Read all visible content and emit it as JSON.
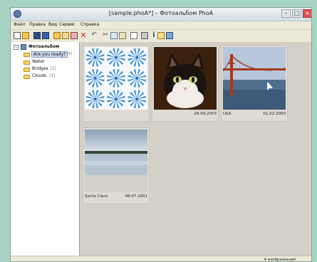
{
  "window": {
    "title": "[sample.phoA*] – Фотоальбом PhoA"
  },
  "menu": [
    "Файл",
    "Правка",
    "Вид",
    "Сервис",
    "Справка"
  ],
  "tree": {
    "root": "Фотоальбом",
    "items": [
      {
        "label": "Are you ready?",
        "count": "(4)",
        "selected": true
      },
      {
        "label": "Water",
        "count": ""
      },
      {
        "label": "Bridges",
        "count": "(1)"
      },
      {
        "label": "Clouds",
        "count": "(1)"
      }
    ]
  },
  "thumbnails": [
    {
      "caption_left": "",
      "caption_right": ""
    },
    {
      "caption_left": "",
      "caption_right": "26.09.2003"
    },
    {
      "caption_left": "USA",
      "caption_right": "01.02.2000"
    },
    {
      "caption_left": "Santa Clara",
      "caption_right": "08.07.2001"
    }
  ],
  "status": {
    "text": "4 изображений"
  },
  "colors": {
    "background": "#a6d3c2",
    "window": "#ece9d8",
    "content": "#d4d0c8",
    "selection": "#c9d6ea"
  }
}
